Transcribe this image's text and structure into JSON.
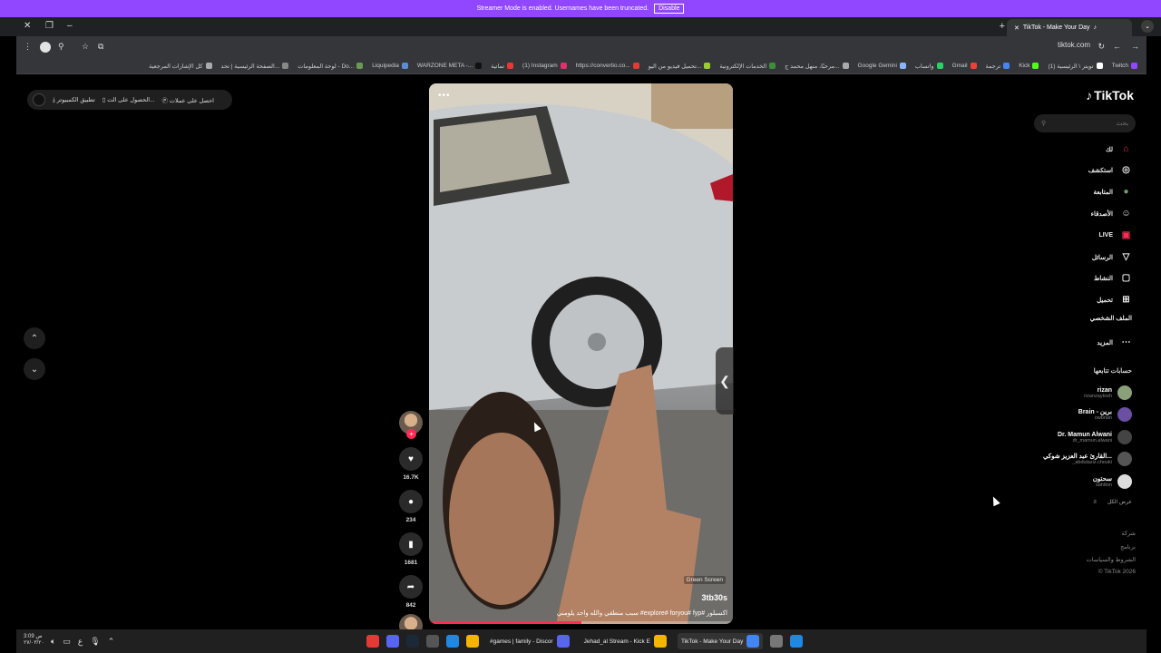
{
  "banner": {
    "text": "Streamer Mode is enabled. Usernames have been truncated.",
    "button": "Disable"
  },
  "window": {
    "tab_title": "TikTok - Make Your Day",
    "url": "tiktok.com"
  },
  "bookmarks": [
    {
      "label": "Twitch",
      "color": "#9147ff"
    },
    {
      "label": "(1) تويتر \\ الرئيسية",
      "color": "#fff"
    },
    {
      "label": "Kick",
      "color": "#53fc18"
    },
    {
      "label": "ترجمة",
      "color": "#4285f4"
    },
    {
      "label": "Gmail",
      "color": "#ea4335"
    },
    {
      "label": "واتساب",
      "color": "#25d366"
    },
    {
      "label": "Google Gemini",
      "color": "#8ab4f8"
    },
    {
      "label": "مرحبًا، منهل محمد ج...",
      "color": "#aaa"
    },
    {
      "label": "الخدمات الإلكترونية",
      "color": "#3c8d3c"
    },
    {
      "label": "تحميل فيديو من اليو...",
      "color": "#9acd32"
    },
    {
      "label": "https://convertio.co...",
      "color": "#e53935"
    },
    {
      "label": "(1) Instagram",
      "color": "#e1306c"
    },
    {
      "label": "تماتية",
      "color": "#e53935"
    },
    {
      "label": "WARZONE META -...",
      "color": "#111"
    },
    {
      "label": "Liquipedia",
      "color": "#5b8bd8"
    },
    {
      "label": "لوحة المعلومات - Do...",
      "color": "#6a9955"
    },
    {
      "label": "الصفحة الرئيسية | تحد...",
      "color": "#888"
    },
    {
      "label": "كل الإشارات المرجعية",
      "color": "#aaa"
    }
  ],
  "get_app": {
    "coins": "احصل على عملات",
    "mobile": "الحصول على الت...",
    "desktop": "تطبيق الكمبيوتر"
  },
  "video": {
    "author": "3tb30s",
    "caption": "سبب منطقي والله واحد يلومني #explore# foryou# fyp# اكسبلور",
    "green_screen": "Green Screen",
    "progress": 0.5
  },
  "actions": {
    "likes": "16.7K",
    "comments": "234",
    "saves": "1681",
    "shares": "842"
  },
  "sidebar": {
    "logo": "TikTok",
    "search_placeholder": "بحث",
    "nav": [
      {
        "label": "لك",
        "icon": "home-icon",
        "glyph": "⌂",
        "color": "#fe2c55"
      },
      {
        "label": "استكشف",
        "icon": "compass-icon",
        "glyph": "◎",
        "color": "#eee"
      },
      {
        "label": "المتابعة",
        "icon": "following-icon",
        "glyph": "●",
        "color": "#6fa36f"
      },
      {
        "label": "الأصدقاء",
        "icon": "friends-icon",
        "glyph": "☺",
        "color": "#eee"
      },
      {
        "label": "LIVE",
        "icon": "live-icon",
        "glyph": "▣",
        "color": "#fe2c55"
      },
      {
        "label": "الرسائل",
        "icon": "messages-icon",
        "glyph": "▽",
        "color": "#eee"
      },
      {
        "label": "النشاط",
        "icon": "activity-icon",
        "glyph": "▢",
        "color": "#eee"
      },
      {
        "label": "تحميل",
        "icon": "upload-icon",
        "glyph": "⊞",
        "color": "#eee"
      },
      {
        "label": "الملف الشخصي",
        "icon": "",
        "glyph": "",
        "color": "#eee"
      },
      {
        "label": "المزيد",
        "icon": "more-icon",
        "glyph": "⋯",
        "color": "#eee"
      }
    ],
    "following_title": "حسابات تتابعها",
    "following": [
      {
        "name": "rizan",
        "handle": "rizanzaytosh",
        "color": "#8aa07a"
      },
      {
        "name": "Brain - برين",
        "handle": "owbrain",
        "color": "#6b4fa3"
      },
      {
        "name": "Dr. Mamun Alwani",
        "handle": "dr_mamun.alwani",
        "color": "#444"
      },
      {
        "name": "القارئ عبد العزيز شوكي...",
        "handle": "_abdulaziz.chouki",
        "color": "#555"
      },
      {
        "name": "سحتون",
        "handle": "sahtton",
        "color": "#ddd"
      }
    ],
    "see_all": "عرض الكل",
    "footer": [
      "شركة",
      "برنامج",
      "الشروط والسياسات",
      "© TikTok 2026"
    ]
  },
  "taskbar": {
    "time": "3:09 ص",
    "date": "٢٧/٠٣/٢٠",
    "apps": [
      {
        "label": "#games | family - Discor",
        "color": "#5865f2"
      },
      {
        "label": "Jehad_al Stream - Kick E",
        "color": "#f4b400"
      },
      {
        "label": "TikTok - Make Your Day",
        "color": "#4285f4",
        "active": true
      }
    ]
  }
}
